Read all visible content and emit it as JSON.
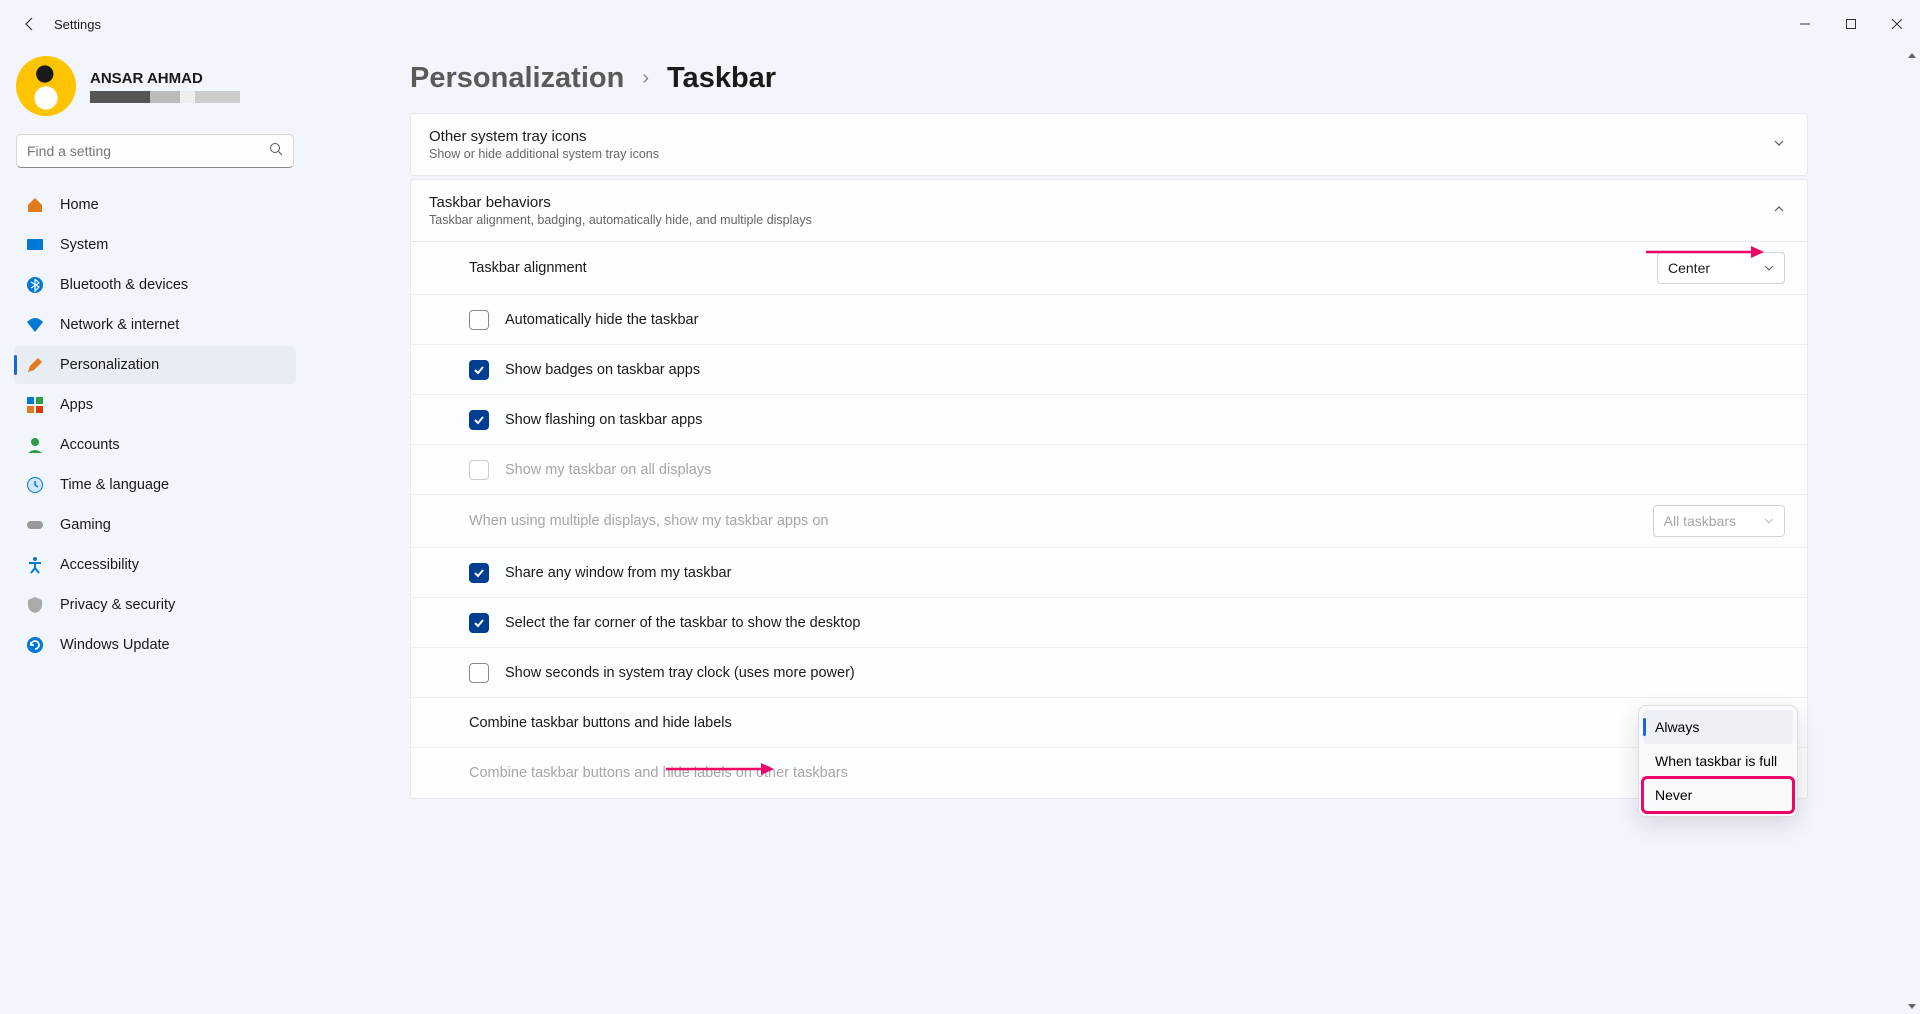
{
  "window": {
    "title": "Settings"
  },
  "profile": {
    "name": "ANSAR AHMAD"
  },
  "search": {
    "placeholder": "Find a setting"
  },
  "nav": {
    "items": [
      {
        "label": "Home"
      },
      {
        "label": "System"
      },
      {
        "label": "Bluetooth & devices"
      },
      {
        "label": "Network & internet"
      },
      {
        "label": "Personalization"
      },
      {
        "label": "Apps"
      },
      {
        "label": "Accounts"
      },
      {
        "label": "Time & language"
      },
      {
        "label": "Gaming"
      },
      {
        "label": "Accessibility"
      },
      {
        "label": "Privacy & security"
      },
      {
        "label": "Windows Update"
      }
    ]
  },
  "breadcrumb": {
    "parent": "Personalization",
    "current": "Taskbar"
  },
  "cards": {
    "tray": {
      "title": "Other system tray icons",
      "sub": "Show or hide additional system tray icons"
    },
    "behaviors": {
      "title": "Taskbar behaviors",
      "sub": "Taskbar alignment, badging, automatically hide, and multiple displays"
    }
  },
  "rows": {
    "alignment": {
      "label": "Taskbar alignment",
      "value": "Center"
    },
    "autohide": {
      "label": "Automatically hide the taskbar"
    },
    "badges": {
      "label": "Show badges on taskbar apps"
    },
    "flashing": {
      "label": "Show flashing on taskbar apps"
    },
    "alldisplays": {
      "label": "Show my taskbar on all displays"
    },
    "multidisplay": {
      "label": "When using multiple displays, show my taskbar apps on",
      "value": "All taskbars"
    },
    "share": {
      "label": "Share any window from my taskbar"
    },
    "farcorner": {
      "label": "Select the far corner of the taskbar to show the desktop"
    },
    "seconds": {
      "label": "Show seconds in system tray clock (uses more power)"
    },
    "combine": {
      "label": "Combine taskbar buttons and hide labels"
    },
    "combineother": {
      "label": "Combine taskbar buttons and hide labels on other taskbars"
    }
  },
  "popup": {
    "opt1": "Always",
    "opt2": "When taskbar is full",
    "opt3": "Never"
  },
  "icons": {
    "home": "#e07b1e",
    "system": "#0078d4",
    "bluetooth": "#0078d4",
    "network": "#0078d4",
    "personalization": "#e07b1e",
    "apps": "#0078d4",
    "accounts": "#2e9c47",
    "time": "#0078d4",
    "gaming": "#888",
    "accessibility": "#0078d4",
    "privacy": "#888",
    "update": "#0078d4"
  }
}
